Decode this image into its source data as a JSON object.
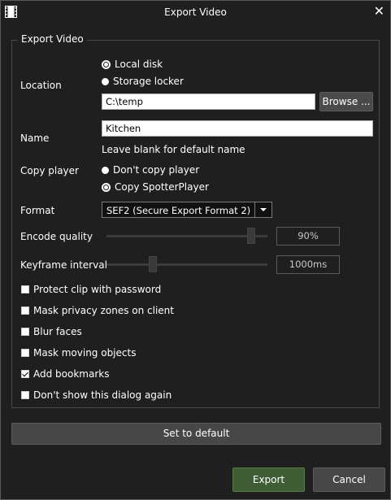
{
  "dialog": {
    "title": "Export Video"
  },
  "group": {
    "title": "Export Video"
  },
  "location": {
    "label": "Location",
    "option_local": "Local disk",
    "option_storage": "Storage locker",
    "selected": "Local disk",
    "path_value": "C:\\temp",
    "browse_label": "Browse ..."
  },
  "name": {
    "label": "Name",
    "value": "Kitchen",
    "hint": "Leave blank for default name"
  },
  "copy_player": {
    "label": "Copy player",
    "option_dont": "Don't copy player",
    "option_copy": "Copy SpotterPlayer",
    "selected": "Copy SpotterPlayer"
  },
  "format": {
    "label": "Format",
    "selected": "SEF2 (Secure Export Format 2)"
  },
  "encode_quality": {
    "label": "Encode quality",
    "value_text": "90%",
    "fraction": 0.9
  },
  "keyframe_interval": {
    "label": "Keyframe interval",
    "value_text": "1000ms",
    "fraction": 0.29
  },
  "options": [
    {
      "label": "Protect clip with password",
      "checked": false
    },
    {
      "label": "Mask privacy zones on client",
      "checked": false
    },
    {
      "label": "Blur faces",
      "checked": false
    },
    {
      "label": "Mask moving objects",
      "checked": false
    },
    {
      "label": "Add bookmarks",
      "checked": true
    },
    {
      "label": "Don't show this dialog again",
      "checked": false
    }
  ],
  "buttons": {
    "set_default": "Set to default",
    "export": "Export",
    "cancel": "Cancel"
  },
  "colors": {
    "export_button": "#3e5d35",
    "background": "#1f1f1f"
  }
}
